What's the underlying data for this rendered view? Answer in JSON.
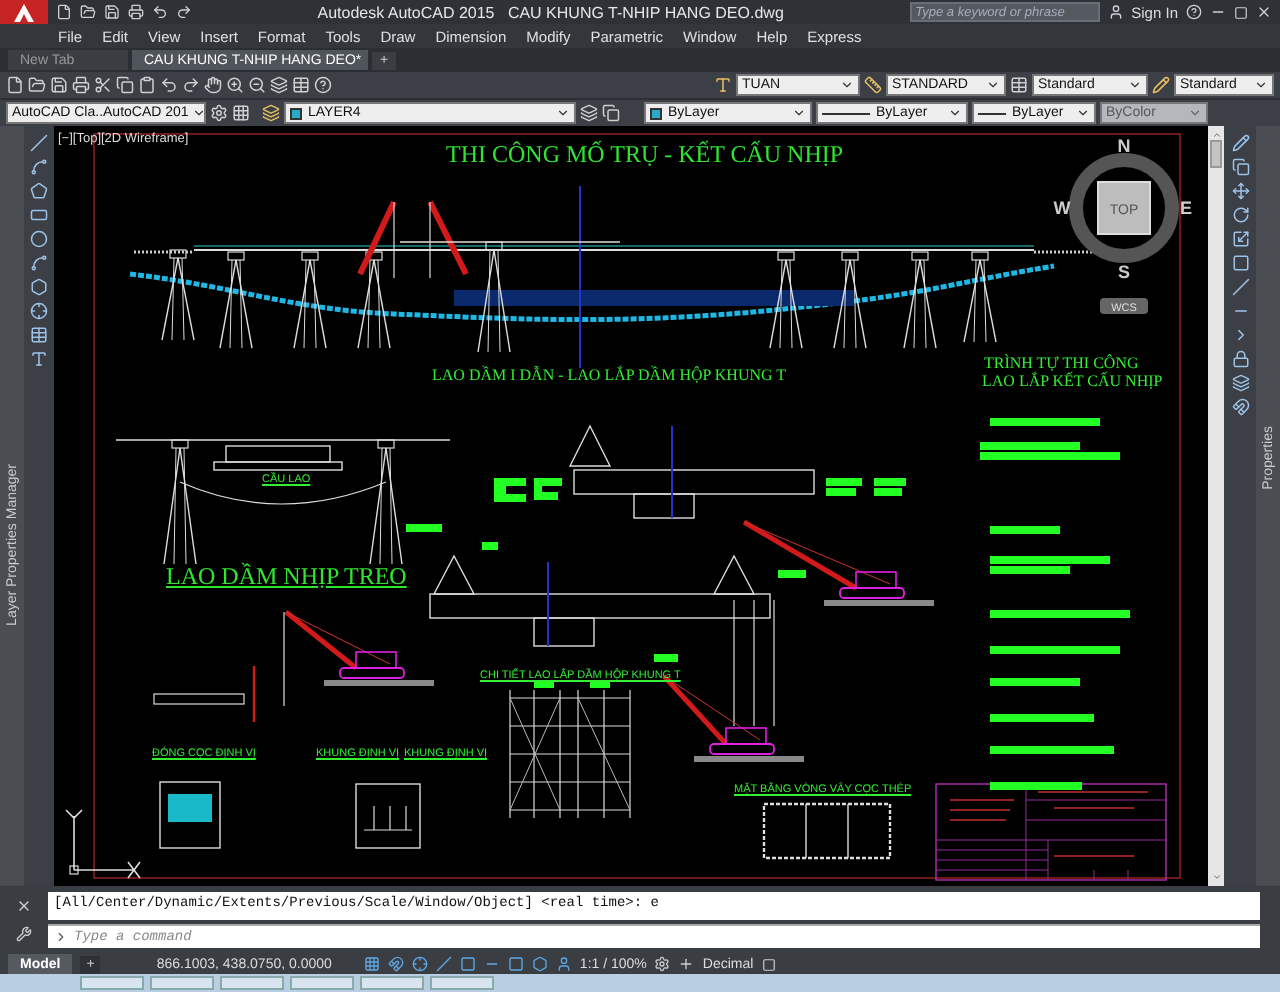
{
  "title_bar": {
    "app_title": "Autodesk AutoCAD 2015",
    "file_name": "CAU KHUNG T-NHIP HANG DEO.dwg",
    "search": {
      "placeholder": "Type a keyword or phrase"
    },
    "sign_in": "Sign In"
  },
  "menu": [
    "File",
    "Edit",
    "View",
    "Insert",
    "Format",
    "Tools",
    "Draw",
    "Dimension",
    "Modify",
    "Parametric",
    "Window",
    "Help",
    "Express"
  ],
  "tabs": [
    {
      "label": "New Tab",
      "selected": false
    },
    {
      "label": "CAU KHUNG T-NHIP HANG DEO*",
      "selected": true
    }
  ],
  "new_tab_button": "+",
  "styles_toolbar": {
    "text_style": "TUAN",
    "dimension_style": "STANDARD",
    "table_style": "Standard",
    "multileader_style": "Standard"
  },
  "layers_toolbar": {
    "workspace": "AutoCAD Cla..AutoCAD 201",
    "layer": "LAYER4",
    "object_color": "ByLayer",
    "linetype": "ByLayer",
    "lineweight": "ByLayer",
    "plot_style": {
      "label": "ByColor",
      "disabled": true
    }
  },
  "left_palette": "Layer Properties Manager",
  "right_palette": "Properties",
  "viewport": {
    "label": "[−][Top][2D Wireframe]",
    "viewcube": {
      "north": "N",
      "south": "S",
      "east": "E",
      "west": "W",
      "face": "TOP",
      "ucs": "WCS"
    },
    "texts": [
      {
        "text": "THI CÔNG MỐ TRỤ - KẾT CẤU NHỊP",
        "kind": "title"
      },
      {
        "text": "LAO DẦM I DẪN - LAO LẮP DẦM HỘP KHUNG T",
        "kind": "heading"
      },
      {
        "text": "CẦU LAO",
        "kind": "label"
      },
      {
        "text": "LAO DẦM NHỊP TREO",
        "kind": "title"
      },
      {
        "text": "TRÌNH TỰ THI CÔNG",
        "kind": "heading"
      },
      {
        "text": "LAO LẮP KẾT CẤU NHỊP",
        "kind": "heading"
      },
      {
        "text": "CHI TIẾT LAO LẮP DẦM HỘP KHUNG T",
        "kind": "label"
      },
      {
        "text": "ĐÓNG CỌC ĐỊNH VỊ",
        "kind": "label"
      },
      {
        "text": "KHUNG ĐỊNH VỊ",
        "kind": "label"
      },
      {
        "text": "KHUNG ĐỊNH VỊ",
        "kind": "label"
      },
      {
        "text": "MẶT BẰNG VÒNG VÂY CỌC THÉP",
        "kind": "label"
      }
    ]
  },
  "command_line": {
    "history": "[All/Center/Dynamic/Extents/Previous/Scale/Window/Object] <real time>:  e",
    "placeholder": "Type a command"
  },
  "status_bar": {
    "layout_tabs": [
      {
        "label": "Model",
        "selected": true
      }
    ],
    "add_layout": "+",
    "coordinates": "866.1003, 438.0750, 0.0000",
    "scale": "1:1 / 100%",
    "units": "Decimal"
  }
}
